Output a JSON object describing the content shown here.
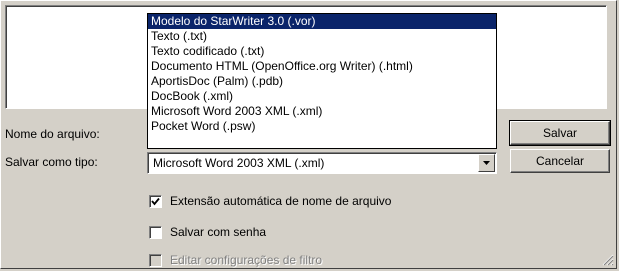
{
  "dialog": {
    "file_name_label": "Nome do arquivo:",
    "file_type_label": "Salvar como tipo:",
    "save_button": "Salvar",
    "cancel_button": "Cancelar"
  },
  "file_type_select": {
    "selected_value": "Microsoft Word 2003 XML (.xml)",
    "options": [
      "Modelo do StarWriter 3.0 (.vor)",
      "Texto (.txt)",
      "Texto codificado (.txt)",
      "Documento HTML (OpenOffice.org Writer) (.html)",
      "AportisDoc (Palm) (.pdb)",
      "DocBook (.xml)",
      "Microsoft Word 2003 XML (.xml)",
      "Pocket Word (.psw)"
    ],
    "highlighted_index": 0
  },
  "options": {
    "auto_extension_label": "Extensão automática de nome de arquivo",
    "auto_extension_checked": true,
    "save_password_label": "Salvar com senha",
    "save_password_checked": false,
    "edit_filter_label": "Editar configurações de filtro",
    "edit_filter_checked": false
  },
  "colors": {
    "dialog_bg": "#d4d0c8",
    "highlight_bg": "#0a246a",
    "highlight_text": "#ffffff",
    "disabled_text": "#808080"
  }
}
